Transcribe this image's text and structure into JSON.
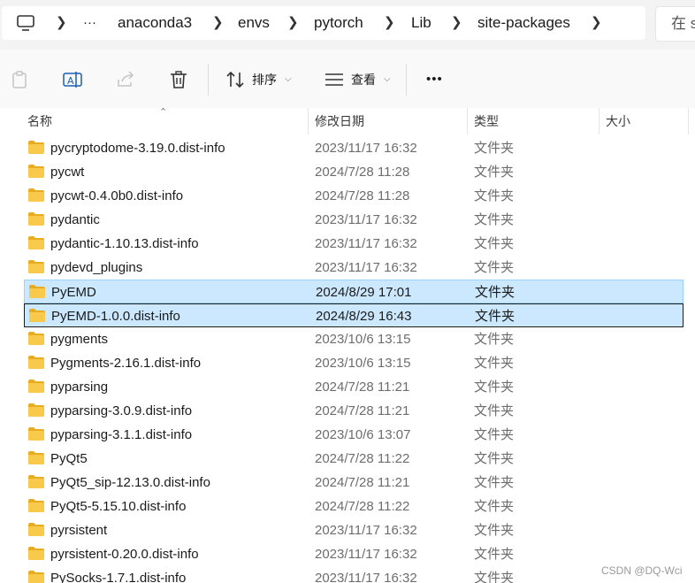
{
  "address": {
    "breadcrumbs": [
      "anaconda3",
      "envs",
      "pytorch",
      "Lib",
      "site-packages"
    ],
    "more_glyph": "···",
    "search_partial": "在 s"
  },
  "toolbar": {
    "sort_label": "排序",
    "view_label": "查看",
    "more_glyph": "•••"
  },
  "columns": {
    "name": "名称",
    "modified": "修改日期",
    "type": "类型",
    "size": "大小"
  },
  "rows": [
    {
      "name": "pycryptodome-3.19.0.dist-info",
      "date": "2023/11/17 16:32",
      "type": "文件夹"
    },
    {
      "name": "pycwt",
      "date": "2024/7/28 11:28",
      "type": "文件夹"
    },
    {
      "name": "pycwt-0.4.0b0.dist-info",
      "date": "2024/7/28 11:28",
      "type": "文件夹"
    },
    {
      "name": "pydantic",
      "date": "2023/11/17 16:32",
      "type": "文件夹"
    },
    {
      "name": "pydantic-1.10.13.dist-info",
      "date": "2023/11/17 16:32",
      "type": "文件夹"
    },
    {
      "name": "pydevd_plugins",
      "date": "2023/11/17 16:32",
      "type": "文件夹"
    },
    {
      "name": "PyEMD",
      "date": "2024/8/29 17:01",
      "type": "文件夹",
      "selected": true
    },
    {
      "name": "PyEMD-1.0.0.dist-info",
      "date": "2024/8/29 16:43",
      "type": "文件夹",
      "selected": true,
      "focused": true
    },
    {
      "name": "pygments",
      "date": "2023/10/6 13:15",
      "type": "文件夹"
    },
    {
      "name": "Pygments-2.16.1.dist-info",
      "date": "2023/10/6 13:15",
      "type": "文件夹"
    },
    {
      "name": "pyparsing",
      "date": "2024/7/28 11:21",
      "type": "文件夹"
    },
    {
      "name": "pyparsing-3.0.9.dist-info",
      "date": "2024/7/28 11:21",
      "type": "文件夹"
    },
    {
      "name": "pyparsing-3.1.1.dist-info",
      "date": "2023/10/6 13:07",
      "type": "文件夹"
    },
    {
      "name": "PyQt5",
      "date": "2024/7/28 11:22",
      "type": "文件夹"
    },
    {
      "name": "PyQt5_sip-12.13.0.dist-info",
      "date": "2024/7/28 11:21",
      "type": "文件夹"
    },
    {
      "name": "PyQt5-5.15.10.dist-info",
      "date": "2024/7/28 11:22",
      "type": "文件夹"
    },
    {
      "name": "pyrsistent",
      "date": "2023/11/17 16:32",
      "type": "文件夹"
    },
    {
      "name": "pyrsistent-0.20.0.dist-info",
      "date": "2023/11/17 16:32",
      "type": "文件夹"
    },
    {
      "name": "PySocks-1.7.1.dist-info",
      "date": "2023/11/17 16:32",
      "type": "文件夹"
    }
  ],
  "watermark": "CSDN @DQ-Wci",
  "colors": {
    "folder": "#f8c94a",
    "folder_dark": "#e8ac21",
    "selection_bg": "#cce8ff",
    "selection_border": "#99d1ff"
  }
}
